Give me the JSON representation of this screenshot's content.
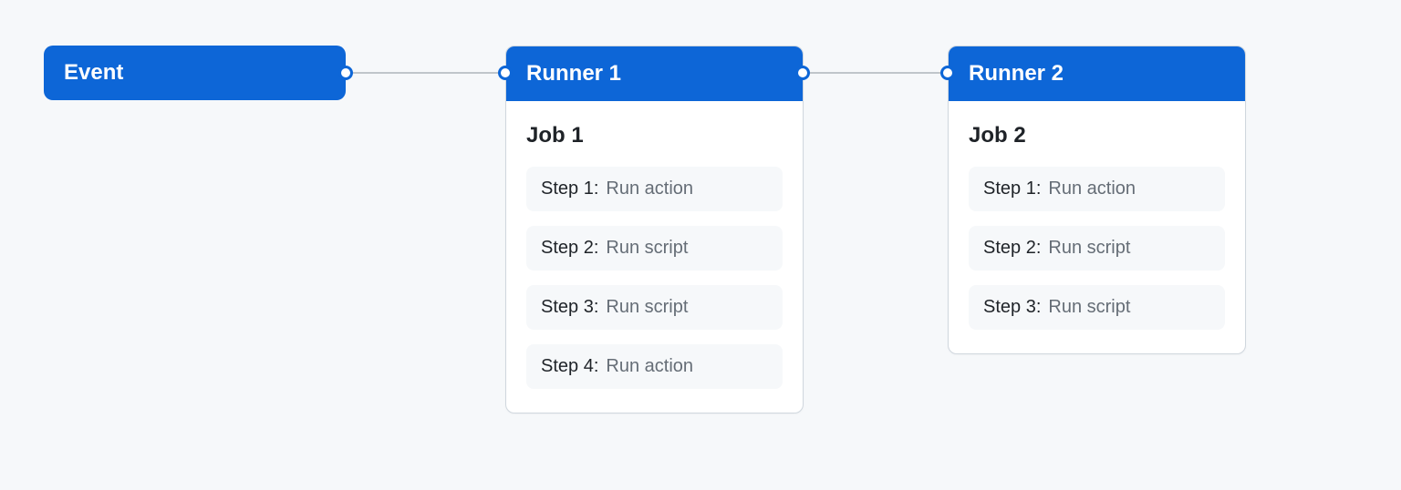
{
  "event": {
    "label": "Event"
  },
  "runners": [
    {
      "title": "Runner 1",
      "job_title": "Job 1",
      "steps": [
        {
          "label": "Step 1:",
          "desc": "Run action"
        },
        {
          "label": "Step 2:",
          "desc": "Run script"
        },
        {
          "label": "Step 3:",
          "desc": "Run script"
        },
        {
          "label": "Step 4:",
          "desc": "Run action"
        }
      ]
    },
    {
      "title": "Runner 2",
      "job_title": "Job 2",
      "steps": [
        {
          "label": "Step 1:",
          "desc": "Run action"
        },
        {
          "label": "Step 2:",
          "desc": "Run script"
        },
        {
          "label": "Step 3:",
          "desc": "Run script"
        }
      ]
    }
  ],
  "colors": {
    "accent": "#0d66d7",
    "background": "#f6f8fa",
    "node_bg": "#ffffff",
    "border": "#d0d7de",
    "text": "#1f2328",
    "muted": "#656d76",
    "connector": "#c0c5ca"
  }
}
